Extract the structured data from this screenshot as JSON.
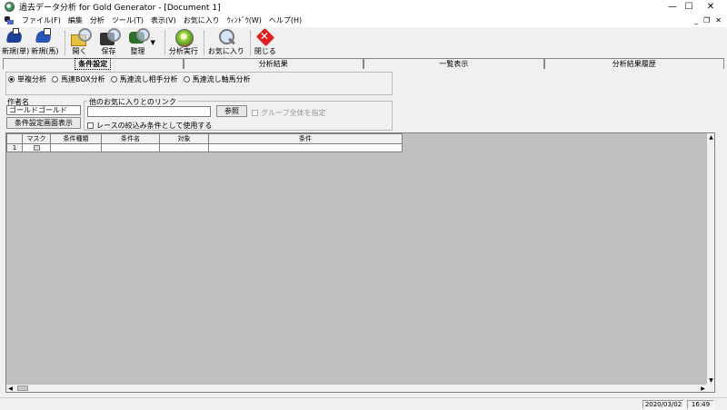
{
  "window": {
    "title": "過去データ分析 for Gold Generator - [Document 1]",
    "minimize": "—",
    "maximize": "☐",
    "close": "✕"
  },
  "menu": {
    "items": [
      "ファイル(F)",
      "編集",
      "分析",
      "ツール(T)",
      "表示(V)",
      "お気に入り",
      "ｳｨﾝﾄﾞｳ(W)",
      "ヘルプ(H)"
    ],
    "mdi_minimize": "_",
    "mdi_restore": "❐",
    "mdi_close": "✕"
  },
  "toolbar": {
    "new_single": "新規(単)",
    "new_horse": "新規(馬)",
    "open": "開く",
    "save": "保存",
    "organize": "整理",
    "dropdown": "▼",
    "run_analysis": "分析実行",
    "favorites": "お気に入り",
    "close": "閉じる"
  },
  "tabs": [
    "条件設定",
    "分析結果",
    "一覧表示",
    "分析結果履歴"
  ],
  "analysis_types": [
    "単複分析",
    "馬連BOX分析",
    "馬連流し相手分析",
    "馬連流し軸馬分析"
  ],
  "author": {
    "label": "作者名",
    "value": "ゴールドゴールド",
    "show_button": "条件設定画面表示"
  },
  "link": {
    "group_label": "他のお気に入りとのリンク",
    "value": "",
    "browse_button": "参照",
    "group_all": "グループ全体を指定",
    "use_as_filter": "レースの絞込み条件として使用する"
  },
  "grid": {
    "headers": [
      "",
      "マスク",
      "条件種類",
      "条件名",
      "対象",
      "条件"
    ],
    "rows": [
      [
        "1",
        "",
        "",
        "",
        "",
        ""
      ]
    ]
  },
  "scroll": {
    "up": "▲",
    "down": "▼",
    "left": "◀",
    "right": "▶"
  },
  "status": {
    "date": "2020/03/02",
    "time": "16:49"
  }
}
